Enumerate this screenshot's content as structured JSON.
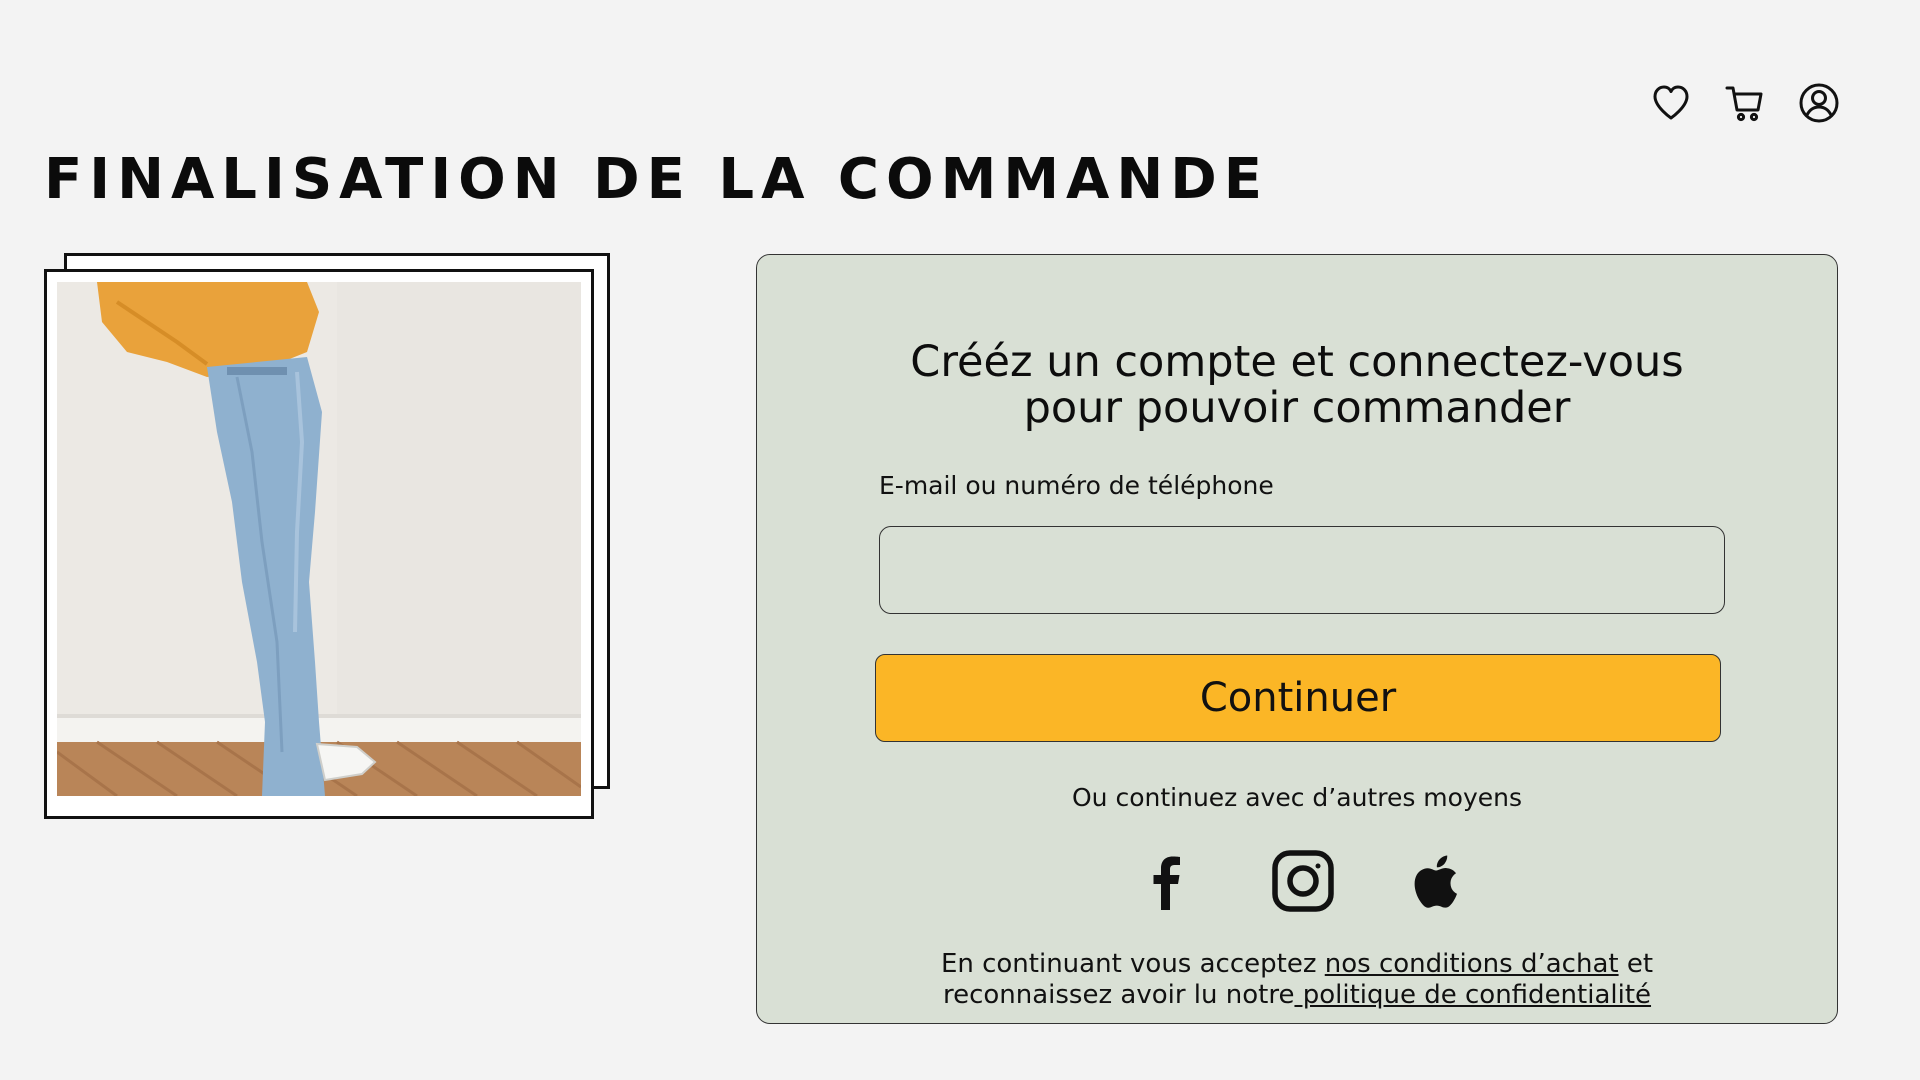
{
  "header": {
    "icons": [
      "heart-icon",
      "cart-icon",
      "user-icon"
    ]
  },
  "page": {
    "title": "FINALISATION DE LA COMMANDE"
  },
  "photo": {
    "description_icon": "product-photo"
  },
  "card": {
    "heading_line1": "Crééz un compte et connectez-vous",
    "heading_line2": "pour pouvoir commander",
    "field_label": "E-mail ou numéro de téléphone",
    "field_value": "",
    "continue_label": "Continuer",
    "alt_text": "Ou continuez avec d’autres moyens",
    "social": [
      "facebook-icon",
      "instagram-icon",
      "apple-icon"
    ],
    "legal_part1": "En continuant vous acceptez ",
    "legal_link1": "nos conditions d’achat",
    "legal_part2": " et",
    "legal_part3": "reconnaissez avoir lu notre",
    "legal_link2": " politique de confidentialité"
  },
  "colors": {
    "background": "#f3f3f3",
    "card_bg": "#d9e0d5",
    "button_accent": "#fbb626",
    "text": "#111111"
  }
}
